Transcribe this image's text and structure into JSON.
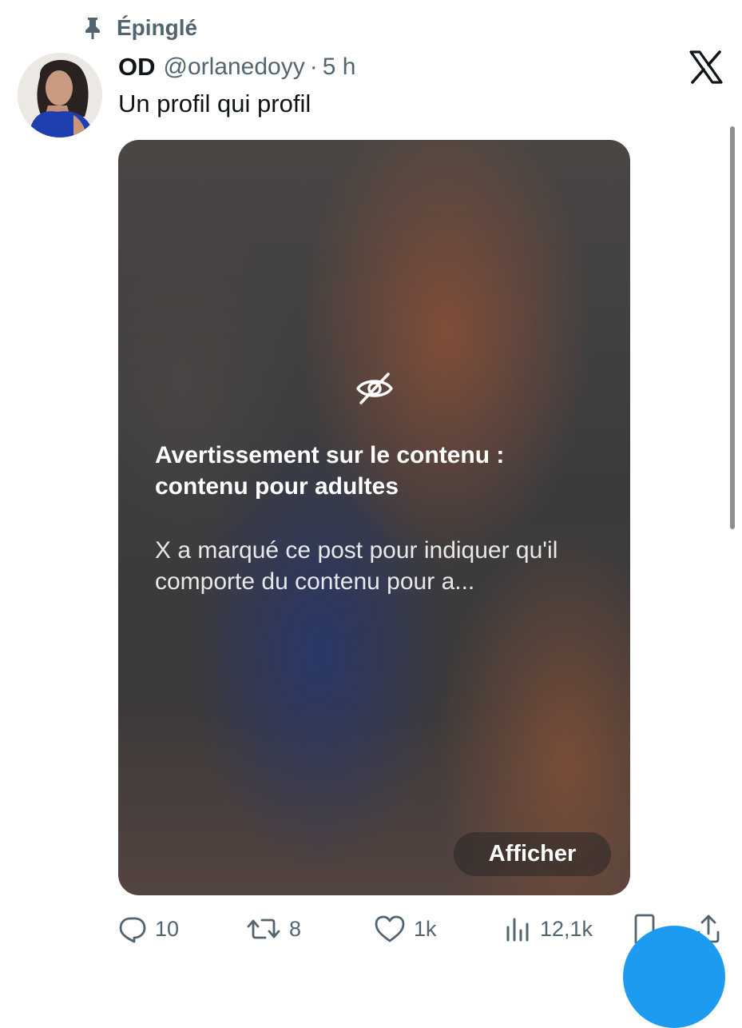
{
  "pinned": {
    "label": "Épinglé",
    "icon": "pin-icon"
  },
  "author": {
    "display_name": "OD",
    "handle": "@orlanedoyy",
    "separator": "·",
    "time": "5 h"
  },
  "post": {
    "text": "Un profil qui profil"
  },
  "media": {
    "warning_title": "Avertissement sur le contenu : contenu pour adultes",
    "warning_body": "X a marqué ce post pour indiquer qu'il comporte du contenu pour a...",
    "show_label": "Afficher",
    "icon": "eye-off-icon"
  },
  "actions": {
    "replies": "10",
    "reposts": "8",
    "likes": "1k",
    "views": "12,1k"
  },
  "colors": {
    "secondary_text": "#536471",
    "accent": "#1d9bf0",
    "primary_text": "#0f1419"
  }
}
